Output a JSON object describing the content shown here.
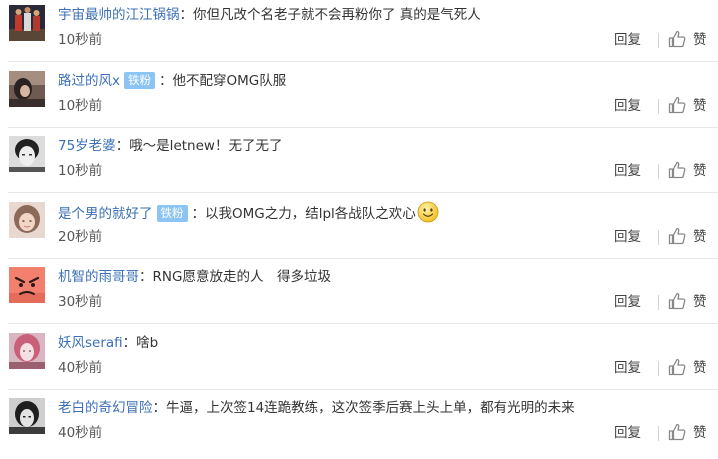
{
  "comments": [
    {
      "username": "宇宙最帅的江江锅锅",
      "badge": "",
      "separator": "：",
      "content": "你但凡改个名老子就不会再粉你了 真的是气死人",
      "time": "10秒前",
      "reply": "回复",
      "like": "赞"
    },
    {
      "username": "路过的风x",
      "badge": "铁粉",
      "separator": "：",
      "content": "他不配穿OMG队服",
      "time": "10秒前",
      "reply": "回复",
      "like": "赞"
    },
    {
      "username": "75岁老婆",
      "badge": "",
      "separator": "：",
      "content": "哦～是letnew！无了无了",
      "time": "10秒前",
      "reply": "回复",
      "like": "赞"
    },
    {
      "username": "是个男的就好了",
      "badge": "铁粉",
      "separator": "：",
      "content": "以我OMG之力，结lpl各战队之欢心",
      "time": "20秒前",
      "reply": "回复",
      "like": "赞"
    },
    {
      "username": "机智的雨哥哥",
      "badge": "",
      "separator": "：",
      "content": "RNG愿意放走的人　得多垃圾",
      "time": "30秒前",
      "reply": "回复",
      "like": "赞"
    },
    {
      "username": "妖风serafi",
      "badge": "",
      "separator": "：",
      "content": "啥b",
      "time": "40秒前",
      "reply": "回复",
      "like": "赞"
    },
    {
      "username": "老白的奇幻冒险",
      "badge": "",
      "separator": "：",
      "content": "牛逼，上次签14连跪教练，这次签季后赛上头上单，都有光明的未来",
      "time": "40秒前",
      "reply": "回复",
      "like": "赞"
    }
  ],
  "colors": {
    "username": "#3b6fb6",
    "badge": "#8cc4f4",
    "divider": "#e6e6e6"
  },
  "icons": {
    "like": "thumbs-up-icon",
    "emoji": "smiley-emoji-icon"
  }
}
